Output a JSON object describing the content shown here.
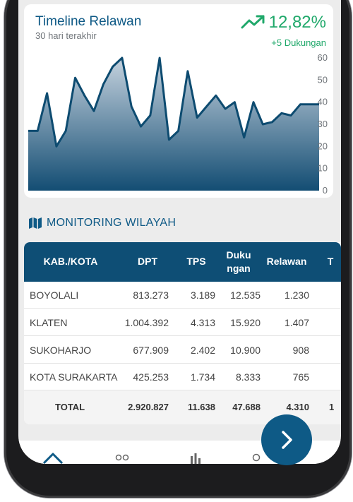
{
  "chart": {
    "title": "Timeline Relawan",
    "subtitle": "30 hari terakhir",
    "growth_value": "12,82%",
    "growth_sub": "+5 Dukungan",
    "trend_icon": "trending-up-icon",
    "accent": "#1fa86a",
    "primary": "#0f5a86"
  },
  "chart_data": {
    "type": "area",
    "x": [
      1,
      2,
      3,
      4,
      5,
      6,
      7,
      8,
      9,
      10,
      11,
      12,
      13,
      14,
      15,
      16,
      17,
      18,
      19,
      20,
      21,
      22,
      23,
      24,
      25,
      26,
      27,
      28,
      29,
      30,
      31,
      32
    ],
    "values": [
      27,
      27,
      44,
      20,
      27,
      51,
      43,
      36,
      48,
      56,
      60,
      38,
      29,
      34,
      60,
      23,
      27,
      54,
      33,
      38,
      43,
      37,
      40,
      24,
      40,
      30,
      31,
      35,
      34,
      39,
      39,
      39
    ],
    "ylim": [
      0,
      60
    ],
    "yticks": [
      "60",
      "50",
      "40",
      "30",
      "20",
      "10",
      "0"
    ],
    "grid": false,
    "colors": {
      "line": "#0d4b70",
      "fill_top": "#c5d2de",
      "fill_bottom": "#134d73"
    }
  },
  "section": {
    "title": "MONITORING WILAYAH",
    "icon": "map-icon"
  },
  "table": {
    "columns": [
      "KAB./KOTA",
      "DPT",
      "TPS",
      "Duku ngan",
      "Relawan",
      "T"
    ],
    "rows": [
      [
        "BOYOLALI",
        "813.273",
        "3.189",
        "12.535",
        "1.230"
      ],
      [
        "KLATEN",
        "1.004.392",
        "4.313",
        "15.920",
        "1.407"
      ],
      [
        "SUKOHARJO",
        "677.909",
        "2.402",
        "10.900",
        "908"
      ],
      [
        "KOTA SURAKARTA",
        "425.253",
        "1.734",
        "8.333",
        "765"
      ]
    ],
    "total": [
      "TOTAL",
      "2.920.827",
      "11.638",
      "47.688",
      "4.310",
      "1"
    ]
  },
  "fab": {
    "icon": "chevron-right-icon"
  },
  "nav": [
    "home-icon",
    "users-icon",
    "bar-chart-icon",
    "profile-icon"
  ]
}
